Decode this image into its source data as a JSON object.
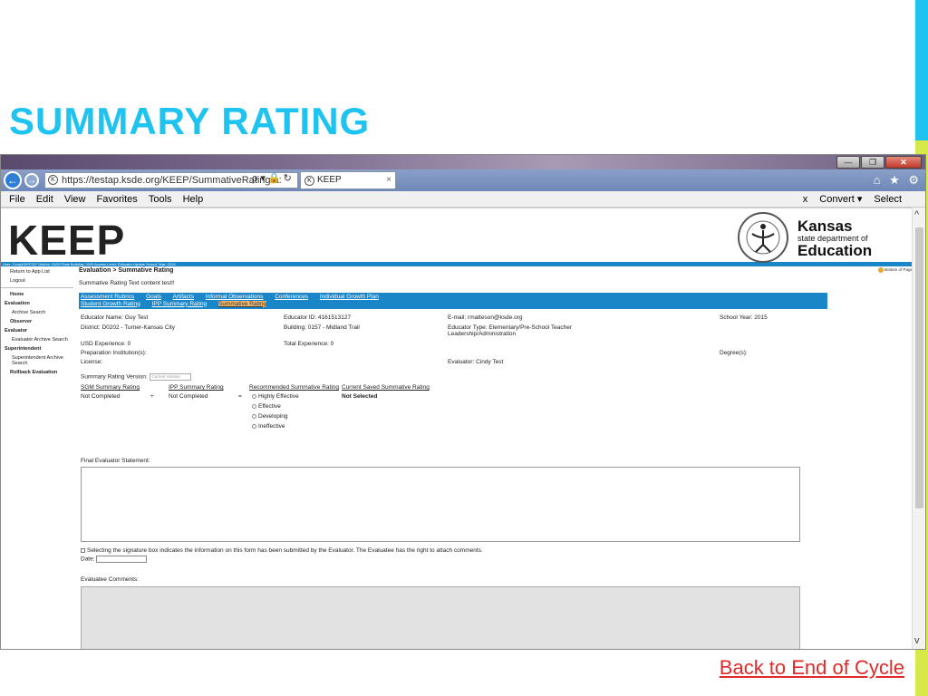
{
  "slide": {
    "title": "SUMMARY RATING",
    "back_link": "Back to End of Cycle",
    "accent_colors": [
      "#1ec3f0",
      "#d7e84a"
    ]
  },
  "browser": {
    "address": "https://testap.ksde.org/KEEP/SummativeRating.a:",
    "addr_icons": "ρ ▾ 🔒 ↻",
    "tab_label": "KEEP",
    "tab_close": "×",
    "window_buttons": [
      "—",
      "❐",
      "✕"
    ],
    "nav_icons": "⌂ ★ ⚙",
    "menu": [
      "File",
      "Edit",
      "View",
      "Favorites",
      "Tools",
      "Help"
    ],
    "menu_right": [
      "x",
      "Convert ▾",
      "Select"
    ]
  },
  "header": {
    "keep_logo": "KEEP",
    "ksde_line1": "Kansas",
    "ksde_line2": "state department of",
    "ksde_line3": "Education"
  },
  "userbar": "User: CindyKEEP207 District: D0257Dale Building: 0000 Access Level: Educator Update School Year: 2015",
  "sidebar": {
    "return": "Return to App List",
    "logout": "Logout",
    "home": "Home",
    "evaluation": "Evaluation",
    "archive_search": "Archive Search",
    "observer": "Observer",
    "evaluator": "Evaluator",
    "evaluator_archive": "Evaluator Archive Search",
    "superintendent": "Superintendent",
    "superintendent_archive": "Superintendent Archive Search",
    "rollback": "Rollback Evaluation"
  },
  "main": {
    "breadcrumb": "Evaluation > Summative Rating",
    "bottom_of_page": "Bottom of Page",
    "content_text": "Summative Rating Text content test!!",
    "tabs_row1": [
      "Assessment Rubrics",
      "Goals",
      "Artifacts",
      "Informal Observations",
      "Conferences",
      "Individual Growth Plan"
    ],
    "tabs_row2": [
      "Student Growth Rating",
      "IPP Summary Rating",
      "Summative Rating"
    ],
    "info": {
      "educator_name": "Educator Name:  Guy Test",
      "educator_id": "Educator ID:  4161513127",
      "email": "E-mail:  rmatteson@ksde.org",
      "school_year": "School Year:  2015",
      "district": "District:  D0202 - Turner-Kansas City",
      "building": "Building:  0157 - Midland Trail",
      "educator_type": "Educator Type:  Elementary/Pre-School Teacher",
      "educator_type2": "Leadership/Administration",
      "usd_exp": "USD Experience:  0",
      "total_exp": "Total Experience:  0",
      "prep": "Preparation Institution(s):",
      "degree": "Degree(s):",
      "license": "License:",
      "evaluator": "Evaluator:  Cindy Test"
    },
    "rating": {
      "version_label": "Summary Rating Version:",
      "version_value": "Current Version",
      "sgm_header": "SGM Summary Rating",
      "ipp_header": "IPP Summary Rating",
      "rec_header": "Recommended Summative Rating",
      "saved_header": "Current Saved Summative Rating",
      "sgm_value": "Not Completed",
      "plus": "+",
      "ipp_value": "Not Completed",
      "equals": "=",
      "options": [
        "Highly Effective",
        "Effective",
        "Developing",
        "Ineffective"
      ],
      "saved_value": "Not Selected"
    },
    "final_statement_label": "Final Evaluator Statement:",
    "signature_text": "Selecting the signature box indicates the information on this form has been submitted by the Evaluator. The Evaluatee has the right to attach comments.",
    "date_label": "Date:",
    "evaluatee_comments_label": "Evaluatee Comments:"
  }
}
